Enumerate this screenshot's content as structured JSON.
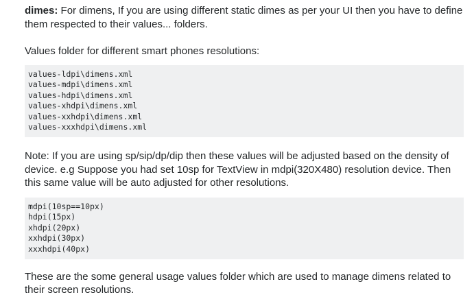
{
  "answer": {
    "intro": {
      "term": "dimes:",
      "text": " For dimens, If you are using different static dimes as per your UI then you have to define them respected to their values... folders."
    },
    "values_heading": "Values folder for different smart phones resolutions:",
    "folders": [
      "values-ldpi\\dimens.xml",
      "values-mdpi\\dimens.xml",
      "values-hdpi\\dimens.xml",
      "values-xhdpi\\dimens.xml",
      "values-xxhdpi\\dimens.xml",
      "values-xxxhdpi\\dimens.xml"
    ],
    "note": "Note: If you are using sp/sip/dp/dip then these values will be adjusted based on the density of device. e.g Suppose you had set 10sp for TextView in mdpi(320X480) resolution device. Then this same value will be auto adjusted for other resolutions.",
    "densities": [
      "mdpi(10sp==10px)",
      "hdpi(15px)",
      "xhdpi(20px)",
      "xxhdpi(30px)",
      "xxxhdpi(40px)"
    ],
    "conclusion": "These are the some general usage values folder which are used to manage dimens related to their screen resolutions."
  }
}
